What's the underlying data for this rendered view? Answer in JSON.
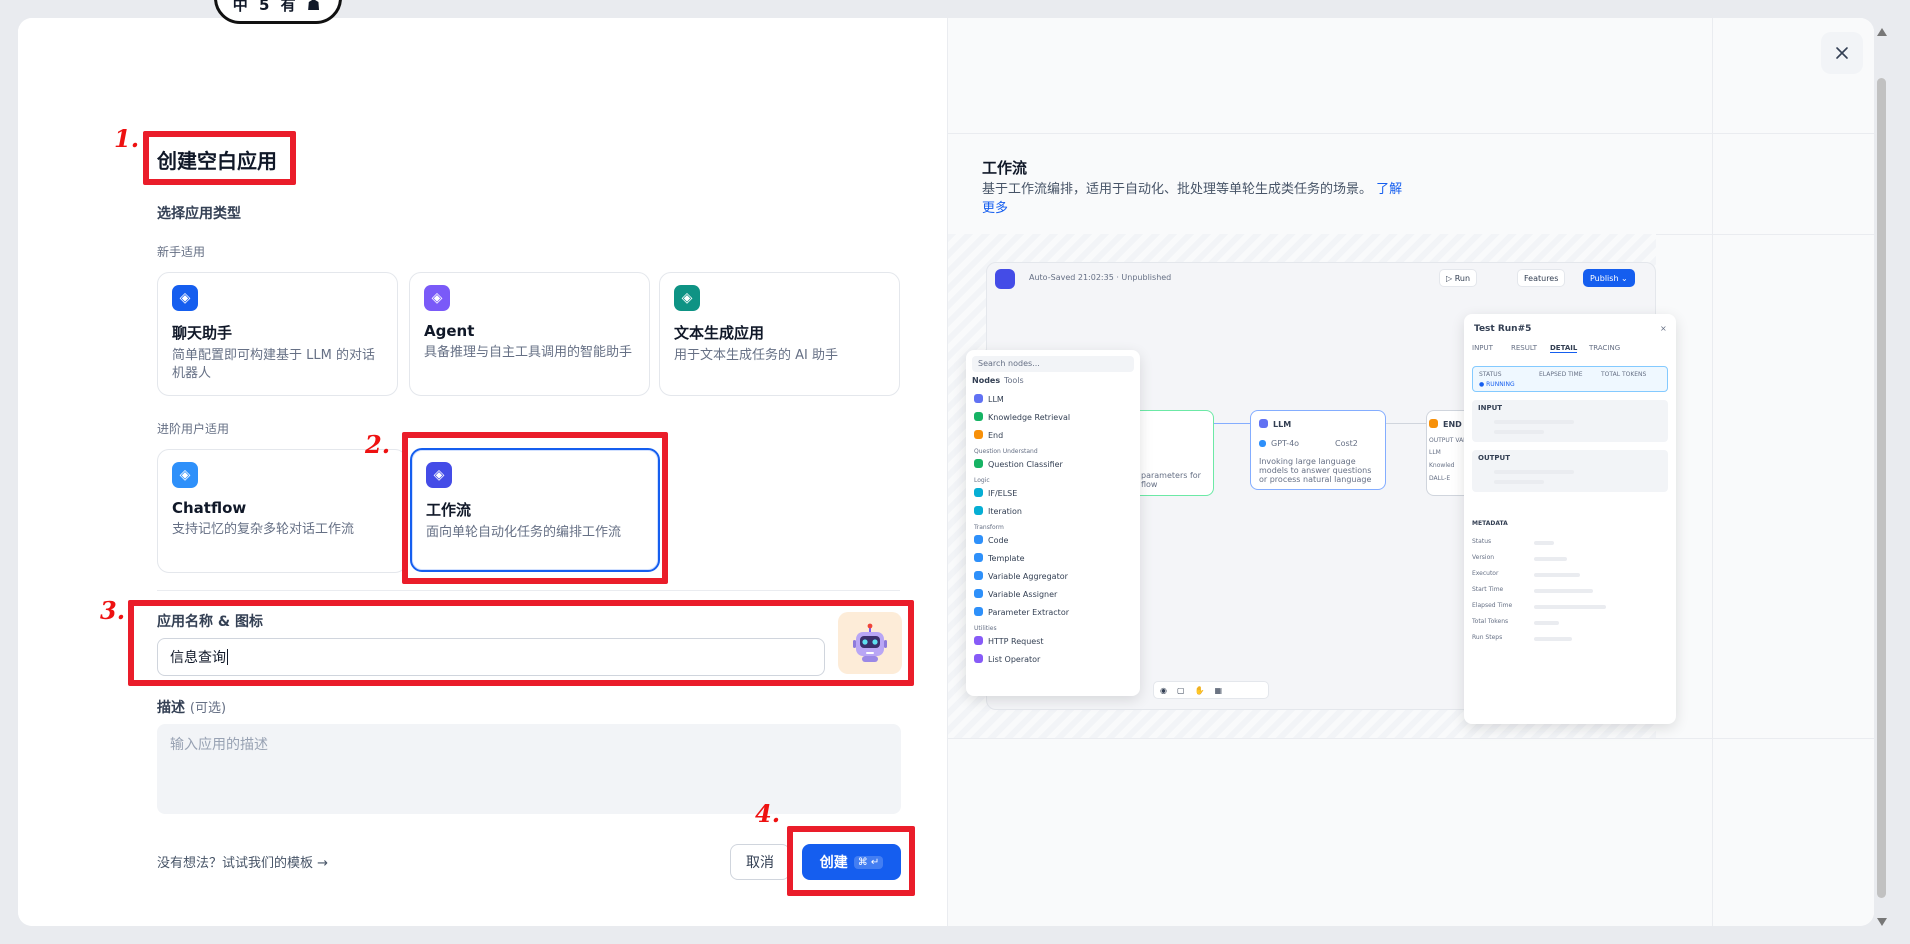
{
  "page": {
    "logo_text": "中 5 有 ☗"
  },
  "annotations": {
    "step1": "1.",
    "step2": "2.",
    "step3": "3.",
    "step4": "4."
  },
  "form": {
    "title": "创建空白应用",
    "type_section_label": "选择应用类型",
    "beginner_label": "新手适用",
    "advanced_label": "进阶用户适用",
    "beginner_cards": [
      {
        "name": "聊天助手",
        "desc": "简单配置即可构建基于 LLM 的对话机器人",
        "color": "#155eef"
      },
      {
        "name": "Agent",
        "desc": "具备推理与自主工具调用的智能助手",
        "color": "#7a5af8"
      },
      {
        "name": "文本生成应用",
        "desc": "用于文本生成任务的 AI 助手",
        "color": "#0e9384"
      }
    ],
    "advanced_cards": [
      {
        "name": "Chatflow",
        "desc": "支持记忆的复杂多轮对话工作流",
        "color": "#2e90fa"
      },
      {
        "name": "工作流",
        "desc": "面向单轮自动化任务的编排工作流",
        "color": "#444ce7",
        "selected": true
      }
    ],
    "name_label": "应用名称 & 图标",
    "name_value": "信息查询",
    "desc_label": "描述",
    "desc_optional": "(可选)",
    "desc_placeholder": "输入应用的描述",
    "template_link": "没有想法？试试我们的模板 →",
    "cancel_label": "取消",
    "create_label": "创建",
    "create_kbd": "⌘ ↵"
  },
  "preview": {
    "title": "工作流",
    "desc": "基于工作流编排，适用于自动化、批处理等单轮生成类任务的场景。",
    "learn_more": "了解更多",
    "canvas": {
      "autosave": "Auto-Saved 21:02:35 · Unpublished",
      "run": "▷ Run",
      "features": "Features",
      "publish": "Publish ⌄",
      "search_placeholder": "Search nodes...",
      "tab_nodes": "Nodes",
      "tab_tools": "Tools",
      "node_list": [
        {
          "t": "item",
          "label": "LLM",
          "color": "#6172f3"
        },
        {
          "t": "item",
          "label": "Knowledge Retrieval",
          "color": "#16b364"
        },
        {
          "t": "item",
          "label": "End",
          "color": "#f79009"
        },
        {
          "t": "group",
          "label": "Question Understand"
        },
        {
          "t": "item",
          "label": "Question Classifier",
          "color": "#16b364"
        },
        {
          "t": "group",
          "label": "Logic"
        },
        {
          "t": "item",
          "label": "IF/ELSE",
          "color": "#06aed4"
        },
        {
          "t": "item",
          "label": "Iteration",
          "color": "#06aed4"
        },
        {
          "t": "group",
          "label": "Transform"
        },
        {
          "t": "item",
          "label": "Code",
          "color": "#2e90fa"
        },
        {
          "t": "item",
          "label": "Template",
          "color": "#2e90fa"
        },
        {
          "t": "item",
          "label": "Variable Aggregator",
          "color": "#2e90fa"
        },
        {
          "t": "item",
          "label": "Variable Assigner",
          "color": "#2e90fa"
        },
        {
          "t": "item",
          "label": "Parameter Extractor",
          "color": "#2e90fa"
        },
        {
          "t": "group",
          "label": "Utilities"
        },
        {
          "t": "item",
          "label": "HTTP Request",
          "color": "#875bf7"
        },
        {
          "t": "item",
          "label": "List Operator",
          "color": "#875bf7"
        }
      ],
      "llm_node_title": "LLM",
      "llm_model": "GPT-4o",
      "llm_model_tag": "Cost2",
      "llm_desc": "Invoking large language models to answer questions or process natural language",
      "start_fragment": "parameters for flow",
      "end_node_title": "END",
      "end_output": "OUTPUT VARIA",
      "end_vars": [
        "LLM",
        "Knowled",
        "DALL-E"
      ],
      "test_run_title": "Test Run#5",
      "test_tabs": [
        "INPUT",
        "RESULT",
        "DETAIL",
        "TRACING"
      ],
      "status_label": "STATUS",
      "status_value": "● RUNNING",
      "elapsed_label": "ELAPSED TIME",
      "tokens_label": "TOTAL TOKENS",
      "input_label": "INPUT",
      "output_label": "OUTPUT",
      "metadata_label": "METADATA",
      "metadata_rows": [
        "Status",
        "Version",
        "Executor",
        "Start Time",
        "Elapsed Time",
        "Total Tokens",
        "Run Steps"
      ]
    }
  }
}
